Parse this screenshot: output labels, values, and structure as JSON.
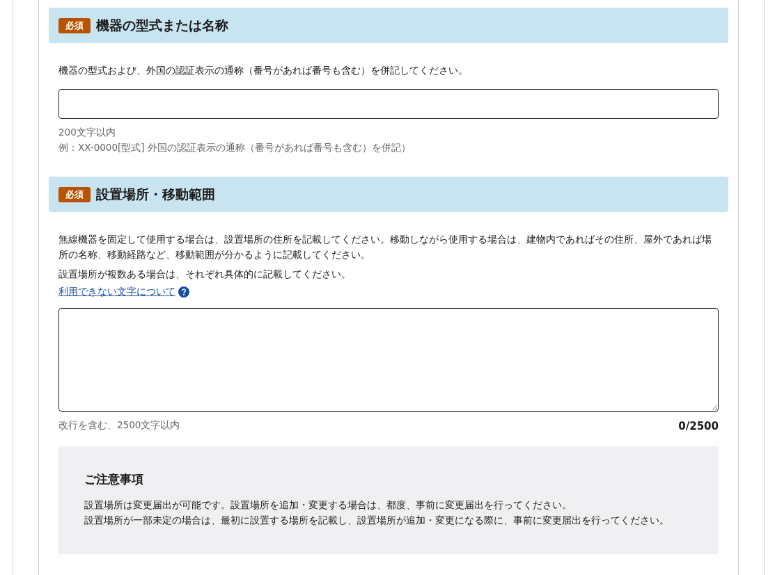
{
  "sections": [
    {
      "required_badge": "必須",
      "title": "機器の型式または名称",
      "kind": "input",
      "descriptions": [
        "機器の型式および、外国の認証表示の通称（番号があれば番号も含む）を併記してください。"
      ],
      "hints": [
        "200文字以内",
        "例：XX-0000[型式] 外国の認証表示の通称（番号があれば番号も含む）を併記）"
      ]
    },
    {
      "required_badge": "必須",
      "title": "設置場所・移動範囲",
      "kind": "textarea",
      "descriptions": [
        "無線機器を固定して使用する場合は、設置場所の住所を記載してください。移動しながら使用する場合は、建物内であればその住所、屋外であれば場所の名称、移動経路など、移動範囲が分かるように記載してください。",
        "設置場所が複数ある場合は、それぞれ具体的に記載してください。"
      ],
      "help_link": "利用できない文字について",
      "hints": [
        "改行を含む、2500文字以内"
      ],
      "counter": "0/2500",
      "notice": {
        "title": "ご注意事項",
        "lines": [
          "設置場所は変更届出が可能です。設置場所を追加・変更する場合は、都度、事前に変更届出を行ってください。",
          "設置場所が一部未定の場合は、最初に設置する場所を記載し、設置場所が追加・変更になる際に、事前に変更届出を行ってください。"
        ]
      }
    }
  ]
}
